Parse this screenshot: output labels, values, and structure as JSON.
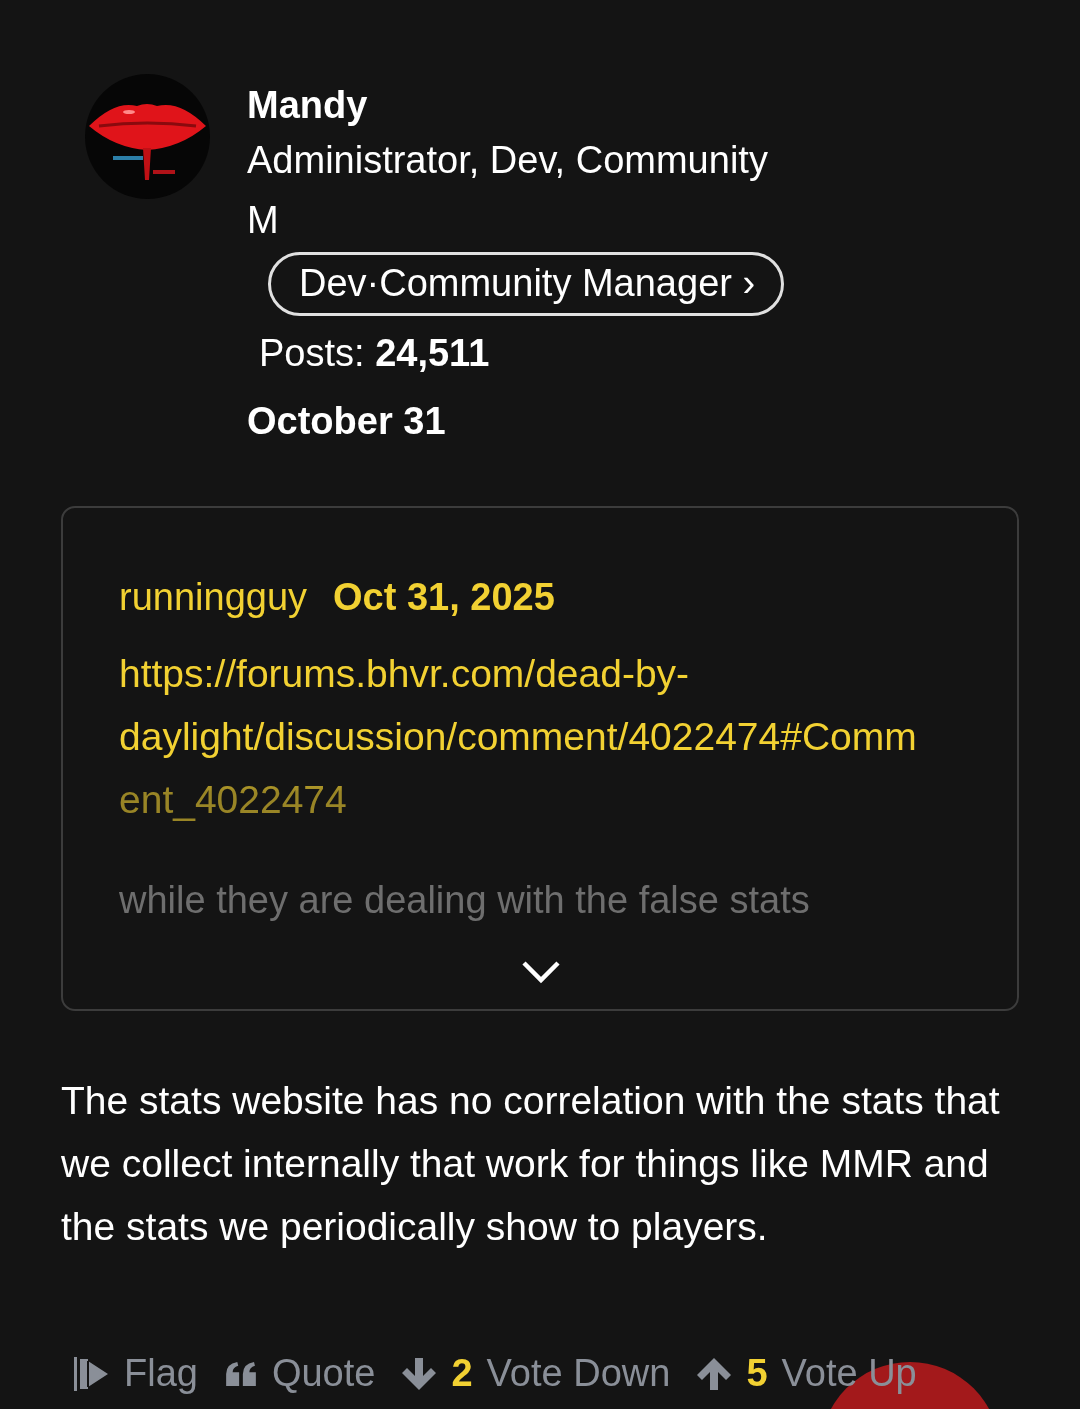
{
  "author": {
    "name": "Mandy",
    "roles": "Administrator, Dev, Community M",
    "role_badge": "Dev·Community Manager ›",
    "posts_label": "Posts:",
    "posts_count": "24,511",
    "date": "October 31"
  },
  "quote": {
    "author": "runningguy",
    "date": "Oct 31, 2025",
    "link": "https://forums.bhvr.com/dead-by-daylight/discussion/comment/4022474#Comment_4022474",
    "excerpt": "while they are dealing with the false stats",
    "collapsed": true
  },
  "body": "The stats website has no correlation with the stats that we collect internally that work for things like MMR and the stats we periodically show to players.",
  "actions": [
    {
      "kind": "flag",
      "label": "Flag"
    },
    {
      "kind": "quote",
      "label": "Quote"
    },
    {
      "kind": "vote_down",
      "count": "2",
      "label": "Vote Down"
    },
    {
      "kind": "vote_up",
      "count": "5",
      "label": "Vote Up"
    }
  ]
}
